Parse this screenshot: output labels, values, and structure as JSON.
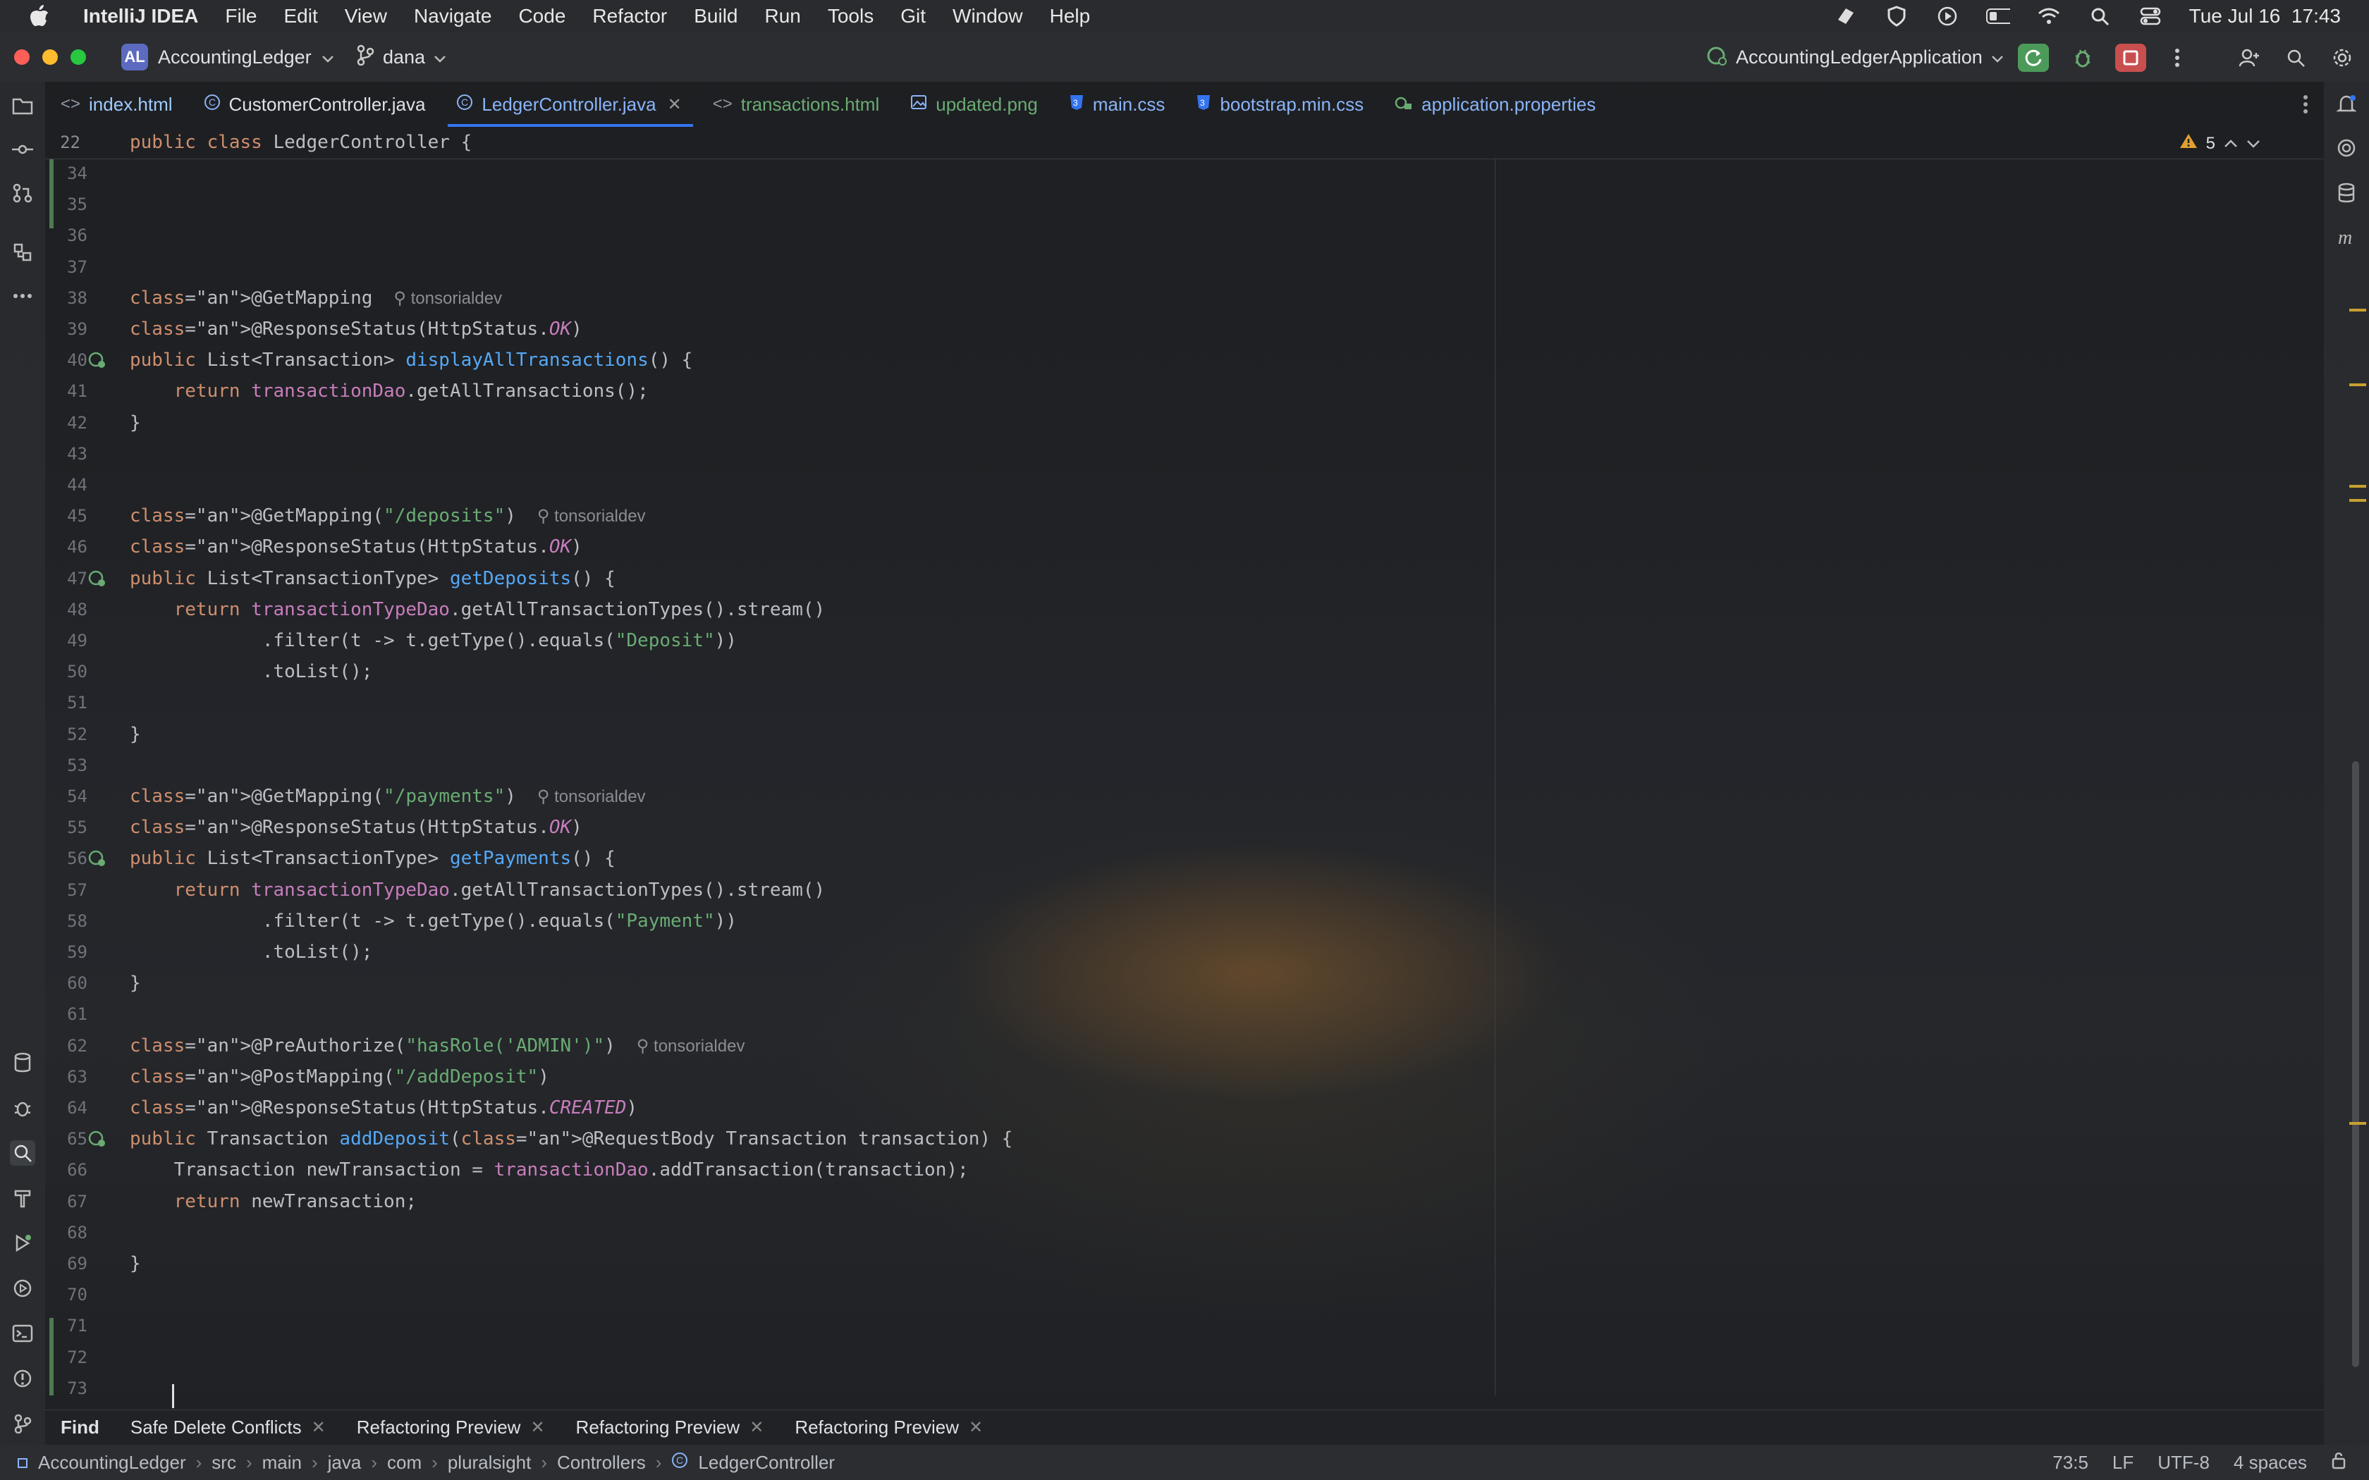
{
  "menubar": {
    "app_name": "IntelliJ IDEA",
    "items": [
      "File",
      "Edit",
      "View",
      "Navigate",
      "Code",
      "Refactor",
      "Build",
      "Run",
      "Tools",
      "Git",
      "Window",
      "Help"
    ],
    "datetime": "Tue Jul 16  17:43"
  },
  "titlebar": {
    "project_badge": "AL",
    "project_name": "AccountingLedger",
    "branch": "dana",
    "run_config": "AccountingLedgerApplication"
  },
  "tabs": [
    {
      "label": "index.html",
      "icon": "html-icon"
    },
    {
      "label": "CustomerController.java",
      "icon": "class-icon"
    },
    {
      "label": "LedgerController.java",
      "icon": "class-icon",
      "active": true
    },
    {
      "label": "transactions.html",
      "icon": "html-icon"
    },
    {
      "label": "updated.png",
      "icon": "image-icon"
    },
    {
      "label": "main.css",
      "icon": "css-icon"
    },
    {
      "label": "bootstrap.min.css",
      "icon": "css-icon"
    },
    {
      "label": "application.properties",
      "icon": "properties-icon"
    }
  ],
  "editor": {
    "sticky_line_number": "22",
    "sticky_text": "public class LedgerController {",
    "warning_count": "5",
    "author": "tonsorialdev",
    "lines": [
      {
        "n": "34"
      },
      {
        "n": "35"
      },
      {
        "n": "36"
      },
      {
        "n": "37"
      },
      {
        "n": "38",
        "code": "@GetMapping",
        "author": true
      },
      {
        "n": "39",
        "code": "@ResponseStatus(HttpStatus.OK)"
      },
      {
        "n": "40",
        "code": "public List<Transaction> displayAllTransactions() {"
      },
      {
        "n": "41",
        "code": "    return transactionDao.getAllTransactions();"
      },
      {
        "n": "42",
        "code": "}"
      },
      {
        "n": "43"
      },
      {
        "n": "44"
      },
      {
        "n": "45",
        "code": "@GetMapping(\"/deposits\")",
        "author": true
      },
      {
        "n": "46",
        "code": "@ResponseStatus(HttpStatus.OK)"
      },
      {
        "n": "47",
        "code": "public List<TransactionType> getDeposits() {"
      },
      {
        "n": "48",
        "code": "    return transactionTypeDao.getAllTransactionTypes().stream()"
      },
      {
        "n": "49",
        "code": "            .filter(t -> t.getType().equals(\"Deposit\"))"
      },
      {
        "n": "50",
        "code": "            .toList();"
      },
      {
        "n": "51"
      },
      {
        "n": "52",
        "code": "}"
      },
      {
        "n": "53"
      },
      {
        "n": "54",
        "code": "@GetMapping(\"/payments\")",
        "author": true
      },
      {
        "n": "55",
        "code": "@ResponseStatus(HttpStatus.OK)"
      },
      {
        "n": "56",
        "code": "public List<TransactionType> getPayments() {"
      },
      {
        "n": "57",
        "code": "    return transactionTypeDao.getAllTransactionTypes().stream()"
      },
      {
        "n": "58",
        "code": "            .filter(t -> t.getType().equals(\"Payment\"))"
      },
      {
        "n": "59",
        "code": "            .toList();"
      },
      {
        "n": "60",
        "code": "}"
      },
      {
        "n": "61"
      },
      {
        "n": "62",
        "code": "@PreAuthorize(\"hasRole('ADMIN')\")",
        "author": true
      },
      {
        "n": "63",
        "code": "@PostMapping(\"/addDeposit\")"
      },
      {
        "n": "64",
        "code": "@ResponseStatus(HttpStatus.CREATED)"
      },
      {
        "n": "65",
        "code": "public Transaction addDeposit(@RequestBody Transaction transaction) {"
      },
      {
        "n": "66",
        "code": "    Transaction newTransaction = transactionDao.addTransaction(transaction);"
      },
      {
        "n": "67",
        "code": "    return newTransaction;"
      },
      {
        "n": "68"
      },
      {
        "n": "69",
        "code": "}"
      },
      {
        "n": "70"
      },
      {
        "n": "71"
      },
      {
        "n": "72"
      },
      {
        "n": "73"
      }
    ]
  },
  "toolwindows": [
    "Find",
    "Safe Delete Conflicts",
    "Refactoring Preview",
    "Refactoring Preview",
    "Refactoring Preview"
  ],
  "statusbar": {
    "breadcrumb": [
      "AccountingLedger",
      "src",
      "main",
      "java",
      "com",
      "pluralsight",
      "Controllers",
      "LedgerController"
    ],
    "position": "73:5",
    "line_ending": "LF",
    "encoding": "UTF-8",
    "indent": "4 spaces"
  },
  "colors": {
    "accent": "#3574f0",
    "run_green": "#4c9a5a",
    "stop_red": "#c94f4f"
  }
}
